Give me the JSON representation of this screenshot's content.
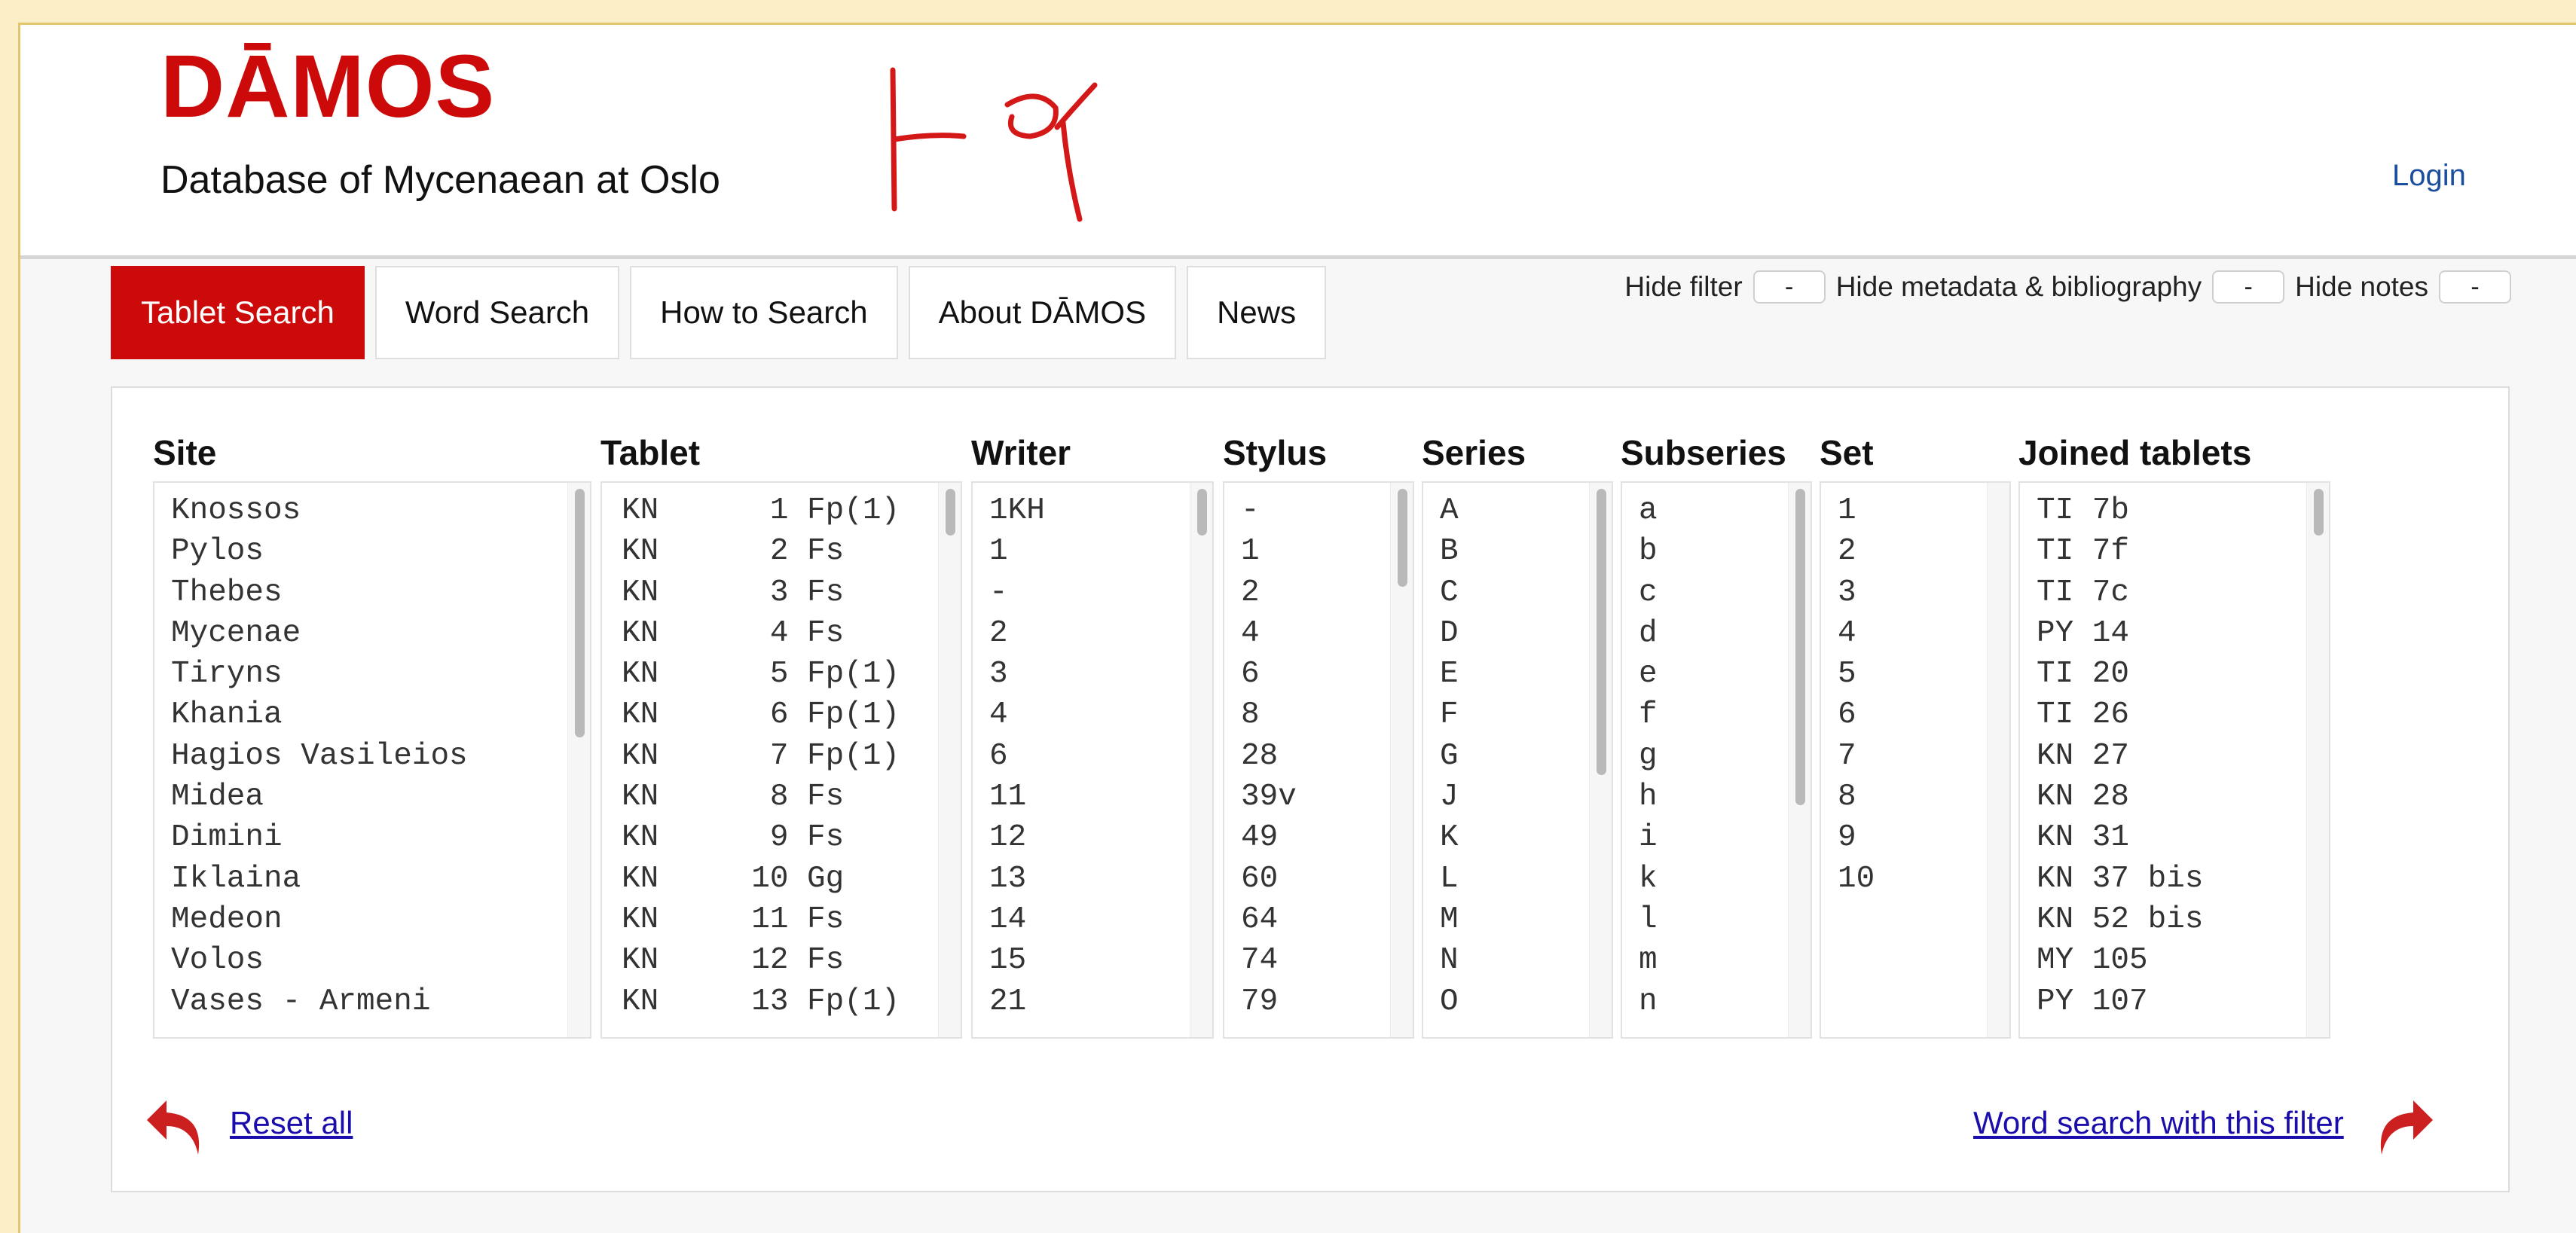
{
  "header": {
    "logo": "DĀMOS",
    "subtitle": "Database of Mycenaean at Oslo",
    "login_label": "Login"
  },
  "nav": {
    "tabs": [
      {
        "label": "Tablet Search",
        "active": true
      },
      {
        "label": "Word Search"
      },
      {
        "label": "How to Search"
      },
      {
        "label": "About DĀMOS"
      },
      {
        "label": "News"
      }
    ]
  },
  "toggles": {
    "hide_filter": "Hide filter",
    "hide_metadata": "Hide metadata & bibliography",
    "hide_notes": "Hide notes",
    "button_label": "-"
  },
  "filters": {
    "site": {
      "header": "Site",
      "items": [
        "Knossos",
        "Pylos",
        "Thebes",
        "Mycenae",
        "Tiryns",
        "Khania",
        "Hagios Vasileios",
        "Midea",
        "Dimini",
        "Iklaina",
        "Medeon",
        "Volos",
        "Vases - Armeni"
      ]
    },
    "tablet": {
      "header": "Tablet",
      "items": [
        "KN      1 Fp(1)",
        "KN      2 Fs",
        "KN      3 Fs",
        "KN      4 Fs",
        "KN      5 Fp(1)",
        "KN      6 Fp(1)",
        "KN      7 Fp(1)",
        "KN      8 Fs",
        "KN      9 Fs",
        "KN     10 Gg",
        "KN     11 Fs",
        "KN     12 Fs",
        "KN     13 Fp(1)"
      ]
    },
    "writer": {
      "header": "Writer",
      "items": [
        "1KH",
        "1",
        "-",
        "2",
        "3",
        "4",
        "6",
        "11",
        "12",
        "13",
        "14",
        "15",
        "21"
      ]
    },
    "stylus": {
      "header": "Stylus",
      "items": [
        "-",
        "1",
        "2",
        "4",
        "6",
        "8",
        "28",
        "39v",
        "49",
        "60",
        "64",
        "74",
        "79"
      ]
    },
    "series": {
      "header": "Series",
      "items": [
        "A",
        "B",
        "C",
        "D",
        "E",
        "F",
        "G",
        "J",
        "K",
        "L",
        "M",
        "N",
        "O"
      ]
    },
    "subseries": {
      "header": "Subseries",
      "items": [
        "a",
        "b",
        "c",
        "d",
        "e",
        "f",
        "g",
        "h",
        "i",
        "k",
        "l",
        "m",
        "n"
      ]
    },
    "set": {
      "header": "Set",
      "items": [
        "1",
        "2",
        "3",
        "4",
        "5",
        "6",
        "7",
        "8",
        "9",
        "10"
      ]
    },
    "joined": {
      "header": "Joined tablets",
      "items": [
        "TI 7b",
        "TI 7f",
        "TI 7c",
        "PY 14",
        "TI 20",
        "TI 26",
        "KN 27",
        "KN 28",
        "KN 31",
        "KN 37 bis",
        "KN 52 bis",
        "MY 105",
        "PY 107"
      ]
    }
  },
  "actions": {
    "reset_all": "Reset all",
    "word_search_filter": "Word search with this filter"
  },
  "colors": {
    "brand_red": "#cc0a0a",
    "link_blue": "#1a0dab",
    "login_blue": "#1c4ea0"
  },
  "icons": {
    "glyph": "linear-b-handwritten-glyph-icon",
    "reset": "curved-arrow-left-icon",
    "forward": "curved-arrow-right-icon"
  }
}
